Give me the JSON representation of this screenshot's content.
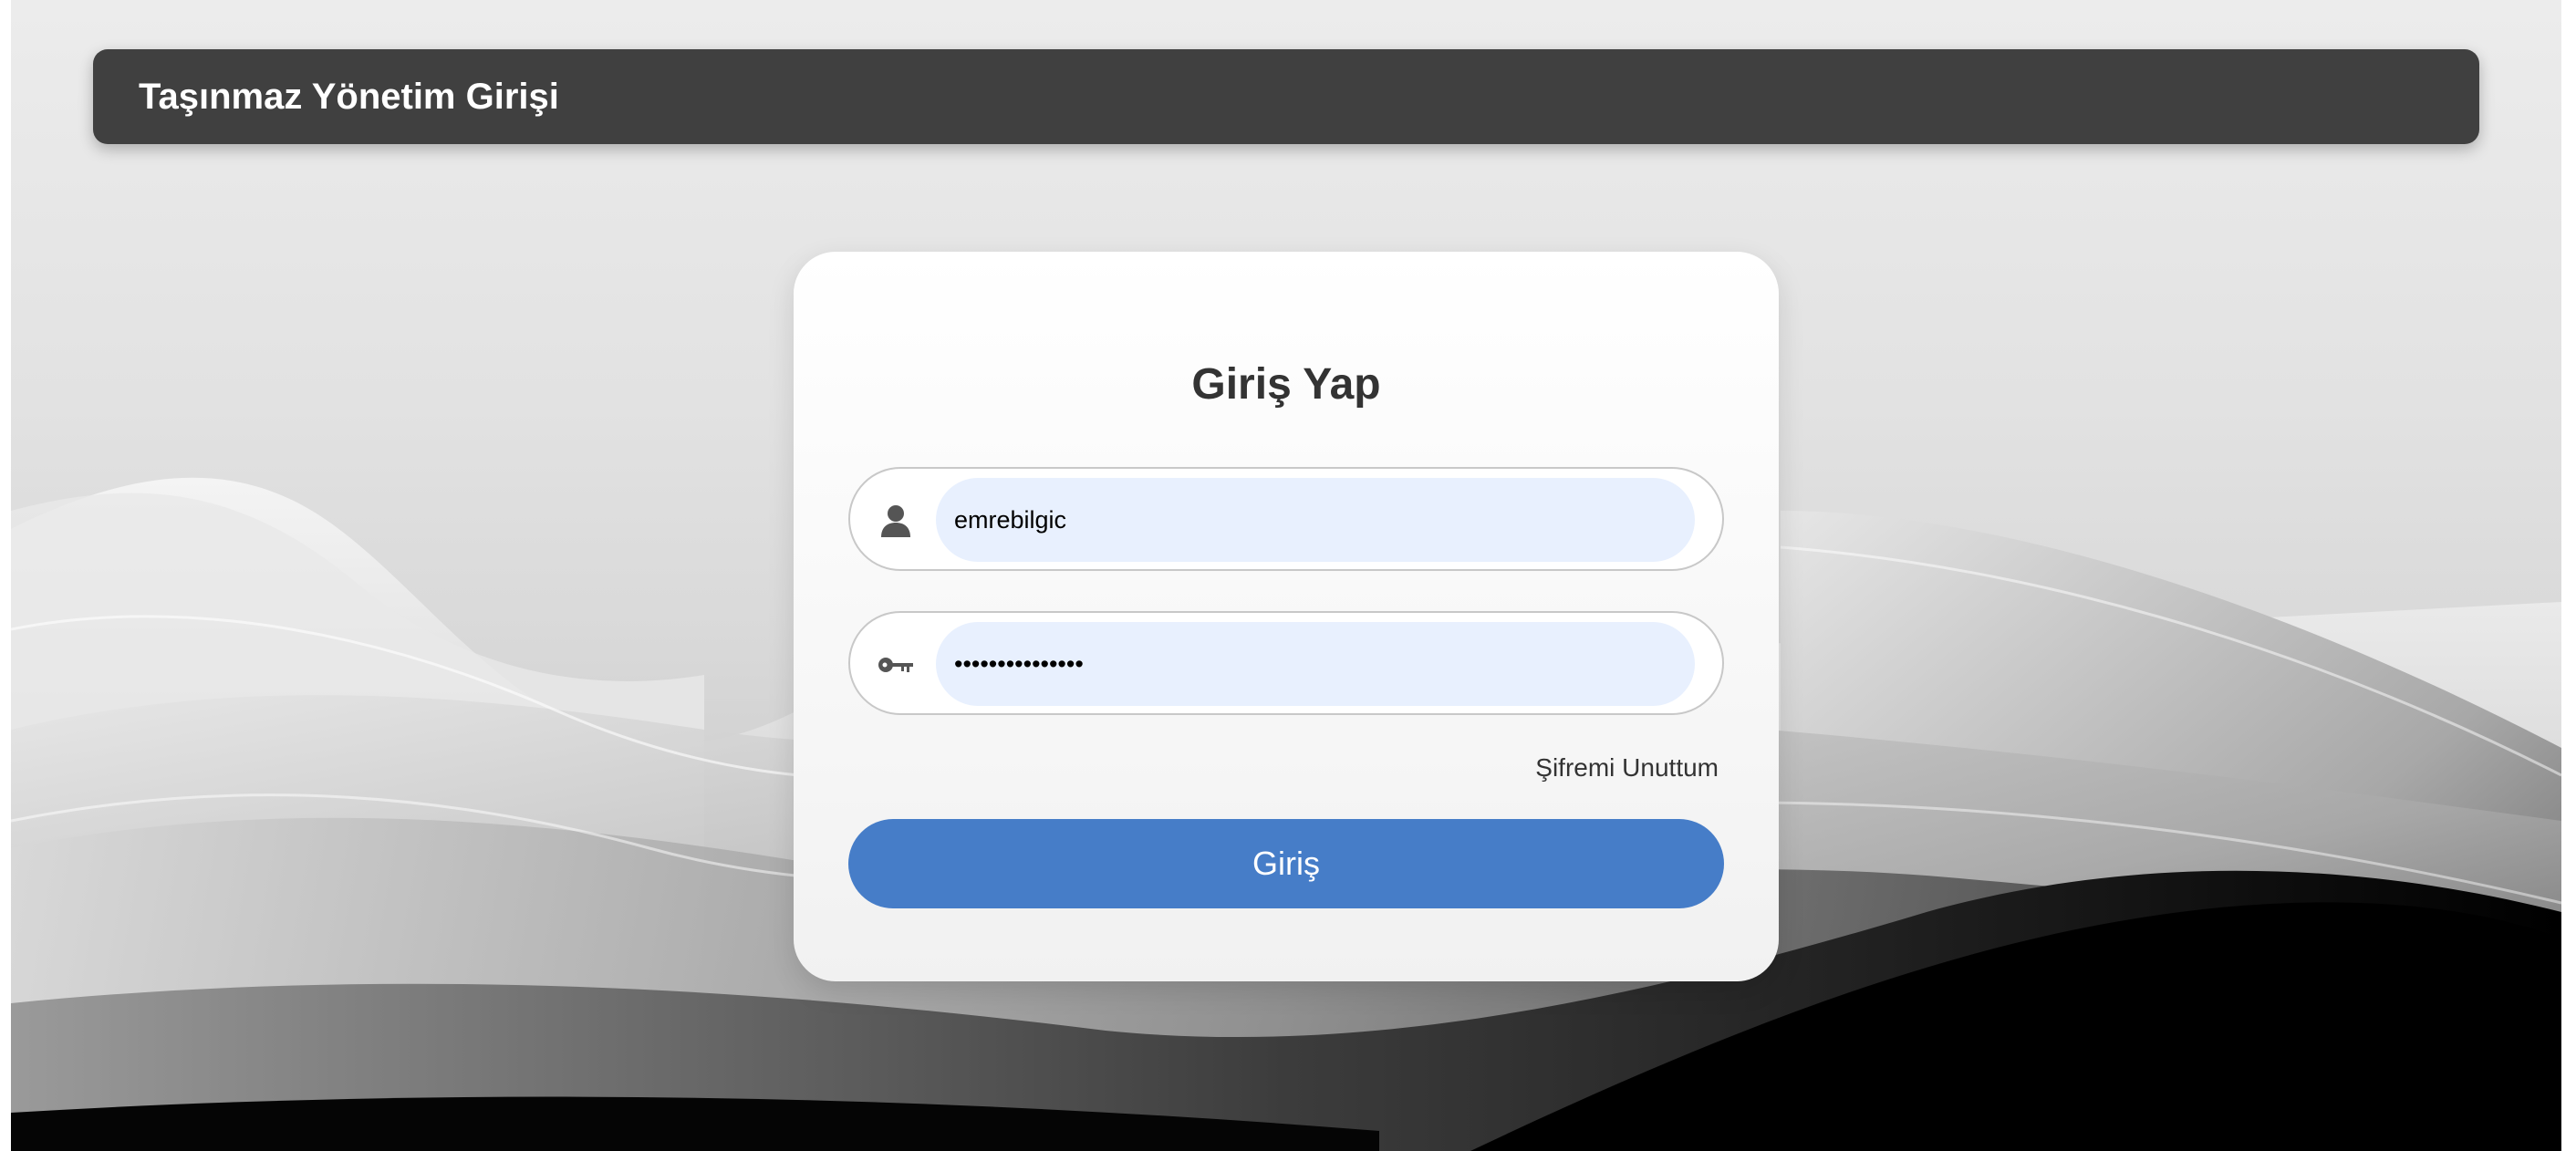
{
  "header": {
    "title": "Taşınmaz Yönetim Girişi"
  },
  "login_card": {
    "title": "Giriş Yap",
    "username": {
      "value": "emrebilgic",
      "icon": "user-icon"
    },
    "password": {
      "value": "•••••••••••••••",
      "icon": "key-icon"
    },
    "forgot_password_label": "Şifremi Unuttum",
    "submit_label": "Giriş"
  },
  "colors": {
    "header_bg": "#404040",
    "button_bg": "#467dc8",
    "input_bg": "#e8f0fe"
  }
}
